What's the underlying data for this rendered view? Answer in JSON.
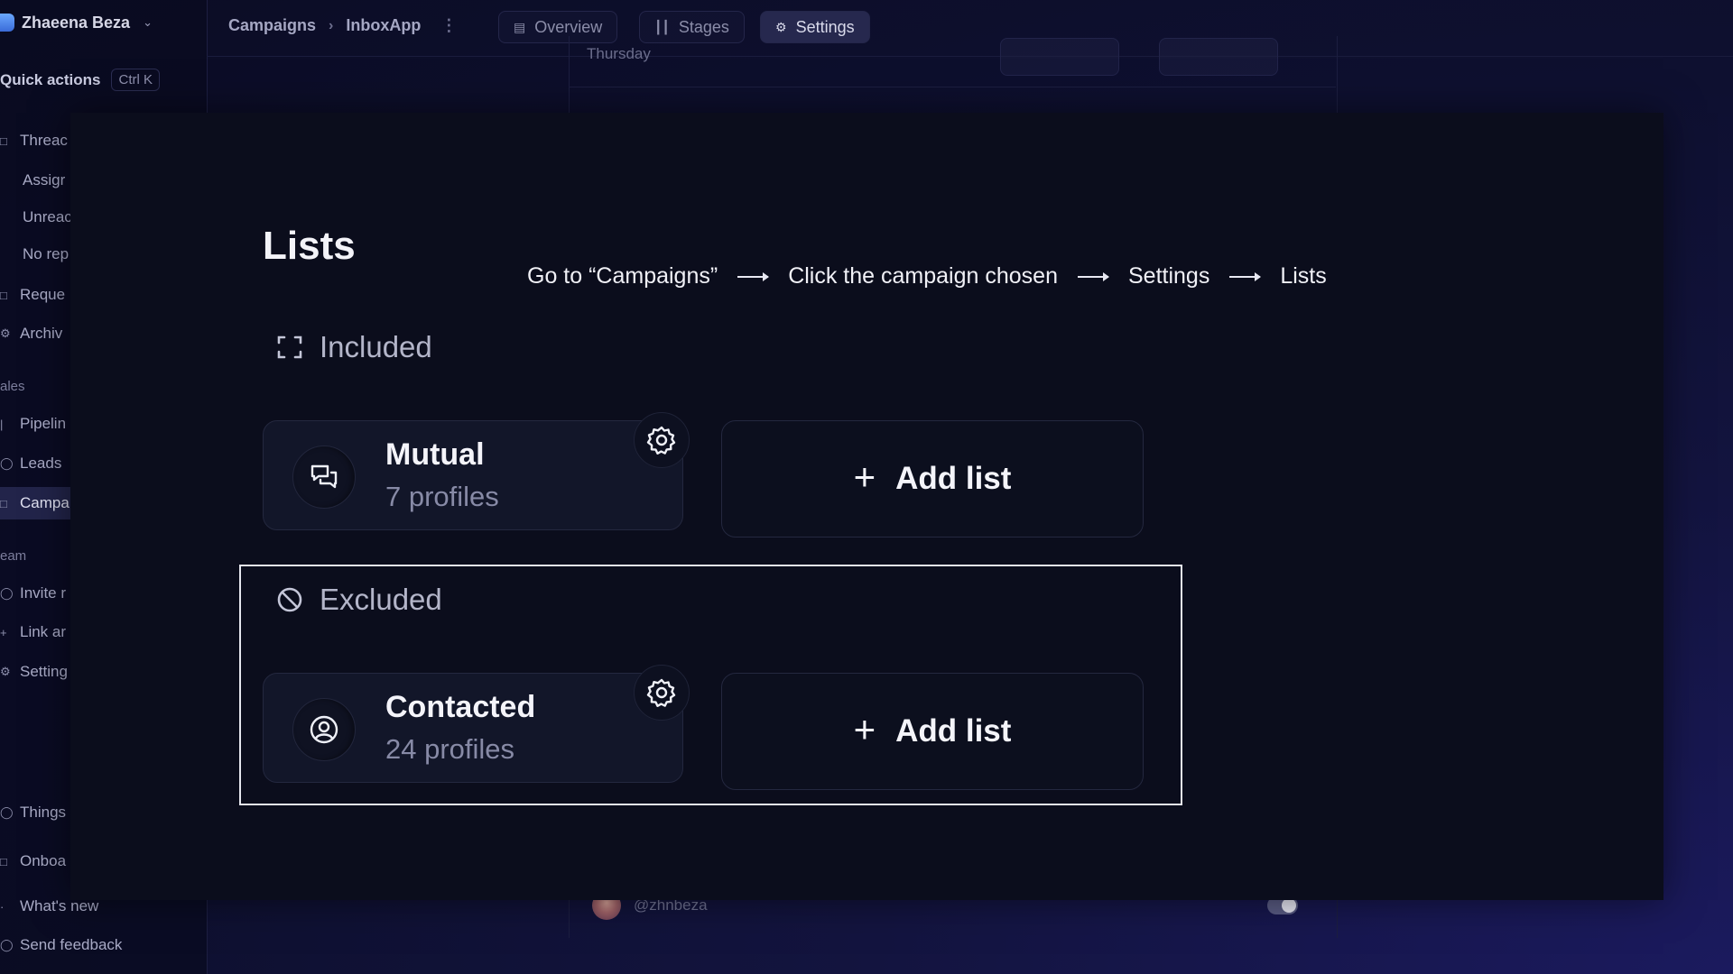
{
  "sidebar": {
    "workspace_name": "Zhaeena Beza",
    "quick_actions": {
      "label": "Quick actions",
      "shortcut": "Ctrl K"
    },
    "items": [
      {
        "label": "Threac"
      },
      {
        "label": "Assigr"
      },
      {
        "label": "Unreac"
      },
      {
        "label": "No rep"
      },
      {
        "label": "Reque"
      },
      {
        "label": "Archiv"
      }
    ],
    "sales_section": "ales",
    "sales_items": [
      {
        "label": "Pipelin"
      },
      {
        "label": "Leads"
      },
      {
        "label": "Campa"
      }
    ],
    "team_section": "eam",
    "team_items": [
      {
        "label": "Invite r"
      },
      {
        "label": "Link ar"
      },
      {
        "label": "Setting"
      }
    ],
    "footer_items": [
      {
        "label": "Things"
      },
      {
        "label": "Onboa"
      },
      {
        "label": "What's new"
      },
      {
        "label": "Send feedback"
      }
    ]
  },
  "topbar": {
    "breadcrumb": [
      "Campaigns",
      "InboxApp"
    ],
    "tabs": [
      {
        "label": "Overview",
        "icon": "bar-chart-icon"
      },
      {
        "label": "Stages",
        "icon": "columns-icon"
      },
      {
        "label": "Settings",
        "icon": "gear-icon"
      }
    ],
    "active_tab": "Settings"
  },
  "background": {
    "day_label": "Thursday",
    "user_handle": "@zhnbeza"
  },
  "overlay": {
    "title": "Lists",
    "steps": [
      "Go to “Campaigns”",
      "Click the campaign chosen",
      "Settings",
      "Lists"
    ],
    "included": {
      "heading": "Included",
      "card": {
        "name": "Mutual",
        "count": "7 profiles",
        "icon": "chat-bubbles-icon"
      },
      "add_label": "Add list"
    },
    "excluded": {
      "heading": "Excluded",
      "card": {
        "name": "Contacted",
        "count": "24 profiles",
        "icon": "user-circle-icon"
      },
      "add_label": "Add list"
    }
  },
  "colors": {
    "background": "#0e1030",
    "overlay": "#0b0d1c",
    "card": "#121629",
    "text_primary": "#f4f4fa",
    "text_muted": "#878aa6",
    "highlight_border": "#e5e6ee"
  }
}
